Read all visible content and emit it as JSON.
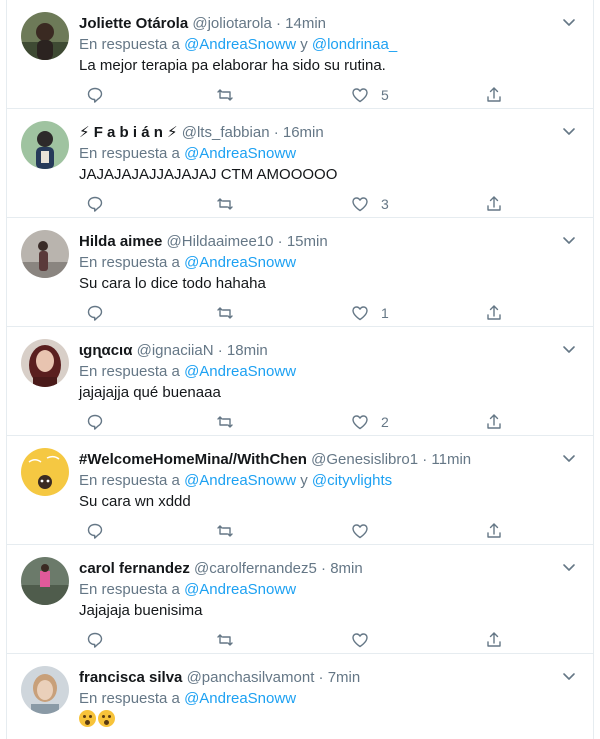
{
  "colors": {
    "link": "#1da1f2",
    "muted": "#657786",
    "text": "#14171a",
    "divider": "#e6ecf0"
  },
  "icons": {
    "reply": "speech-bubble-icon",
    "retweet": "retweet-arrows-icon",
    "like": "heart-icon",
    "share": "share-upload-icon",
    "more": "chevron-down-icon"
  },
  "tweets": [
    {
      "name": "Joliette Otárola",
      "handle": "@joliotarola",
      "time": "· 14min",
      "reply_prefix": "En respuesta a",
      "mention1": "@AndreaSnoww",
      "conj": "y",
      "mention2": "@londrinaa_",
      "text": "La mejor terapia pa elaborar ha sido su rutina.",
      "likes": "5"
    },
    {
      "name": "⚡ F a b i á n ⚡",
      "handle": "@lts_fabbian",
      "time": "· 16min",
      "reply_prefix": "En respuesta a",
      "mention1": "@AndreaSnoww",
      "text": "JAJAJAJAJJAJAJAJ CTM AMOOOOO",
      "likes": "3"
    },
    {
      "name": "Hilda aimee",
      "handle": "@Hildaaimee10",
      "time": "· 15min",
      "reply_prefix": "En respuesta a",
      "mention1": "@AndreaSnoww",
      "text": "Su cara lo dice todo hahaha",
      "likes": "1"
    },
    {
      "name": "ɩgɳαcια",
      "handle": "@ignaciiaN",
      "time": "· 18min",
      "reply_prefix": "En respuesta a",
      "mention1": "@AndreaSnoww",
      "text": "jajajajja qué buenaaa",
      "likes": "2"
    },
    {
      "name": "#WelcomeHomeMina//WithChen",
      "handle": "@Genesislibro1",
      "time": "· 11min",
      "reply_prefix": "En respuesta a",
      "mention1": "@AndreaSnoww",
      "conj": "y",
      "mention2": "@cityvlights",
      "text": "Su cara wn xddd",
      "likes": ""
    },
    {
      "name": "carol fernandez",
      "handle": "@carolfernandez5",
      "time": "· 8min",
      "reply_prefix": "En respuesta a",
      "mention1": "@AndreaSnoww",
      "text": "Jajajaja buenisima",
      "likes": ""
    },
    {
      "name": "francisca silva",
      "handle": "@panchasilvamont",
      "time": "· 7min",
      "reply_prefix": "En respuesta a",
      "mention1": "@AndreaSnoww",
      "text": "",
      "emoji": [
        "hushed-face-emoji",
        "hushed-face-emoji"
      ],
      "likes": ""
    }
  ]
}
